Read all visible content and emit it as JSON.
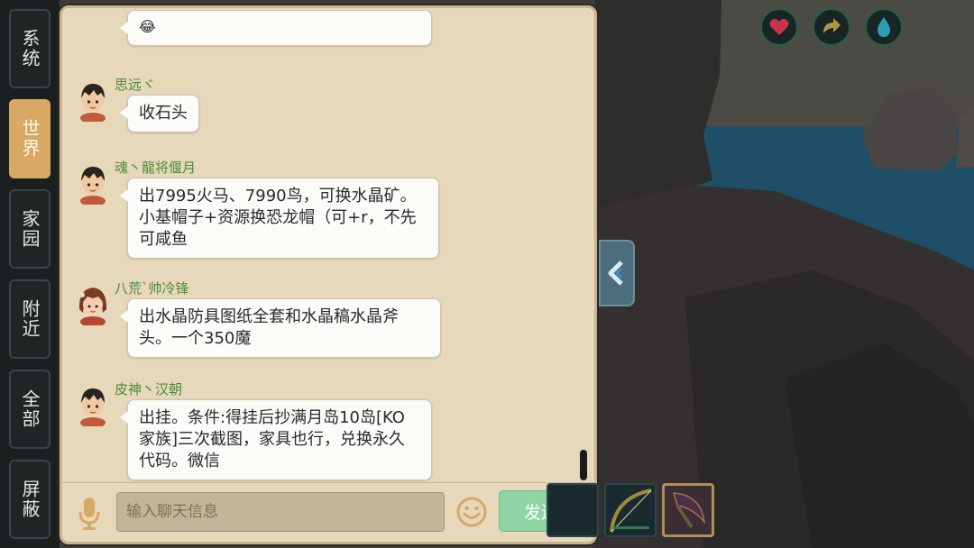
{
  "tabs": [
    {
      "label": "系统",
      "active": false
    },
    {
      "label": "世界",
      "active": true
    },
    {
      "label": "家园",
      "active": false
    },
    {
      "label": "附近",
      "active": false
    },
    {
      "label": "全部",
      "active": false
    },
    {
      "label": "屏蔽",
      "active": false
    }
  ],
  "messages": [
    {
      "sender": "",
      "text": "😂",
      "avatar": "boy-avatar"
    },
    {
      "sender": "思远ヾ",
      "text": "收石头",
      "avatar": "boy-avatar"
    },
    {
      "sender": "魂丶龍将偃月",
      "text": "出7995火马、7990鸟，可换水晶矿。小基帽子+资源换恐龙帽（可+r，不先可咸鱼",
      "avatar": "boy-avatar"
    },
    {
      "sender": "八荒`帅冷锋",
      "text": "出水晶防具图纸全套和水晶稿水晶斧头。一个350魔",
      "avatar": "girl-avatar"
    },
    {
      "sender": "皮神丶汉朝",
      "text": "出挂。条件:得挂后抄满月岛10岛[KO家族]三次截图，家具也行，兑换永久代码。微信",
      "avatar": "boy-avatar"
    }
  ],
  "input": {
    "placeholder": "输入聊天信息",
    "value": ""
  },
  "send_label": "发送",
  "status_icons": [
    "heart-icon",
    "stamina-icon",
    "water-drop-icon"
  ],
  "hotbar": [
    "empty-slot",
    "bow-item",
    "sickle-item"
  ],
  "colors": {
    "panel": "#e7d8bb",
    "active_tab": "#d9a864",
    "send": "#8fd4a4",
    "sender_name": "#4a8a3a"
  }
}
